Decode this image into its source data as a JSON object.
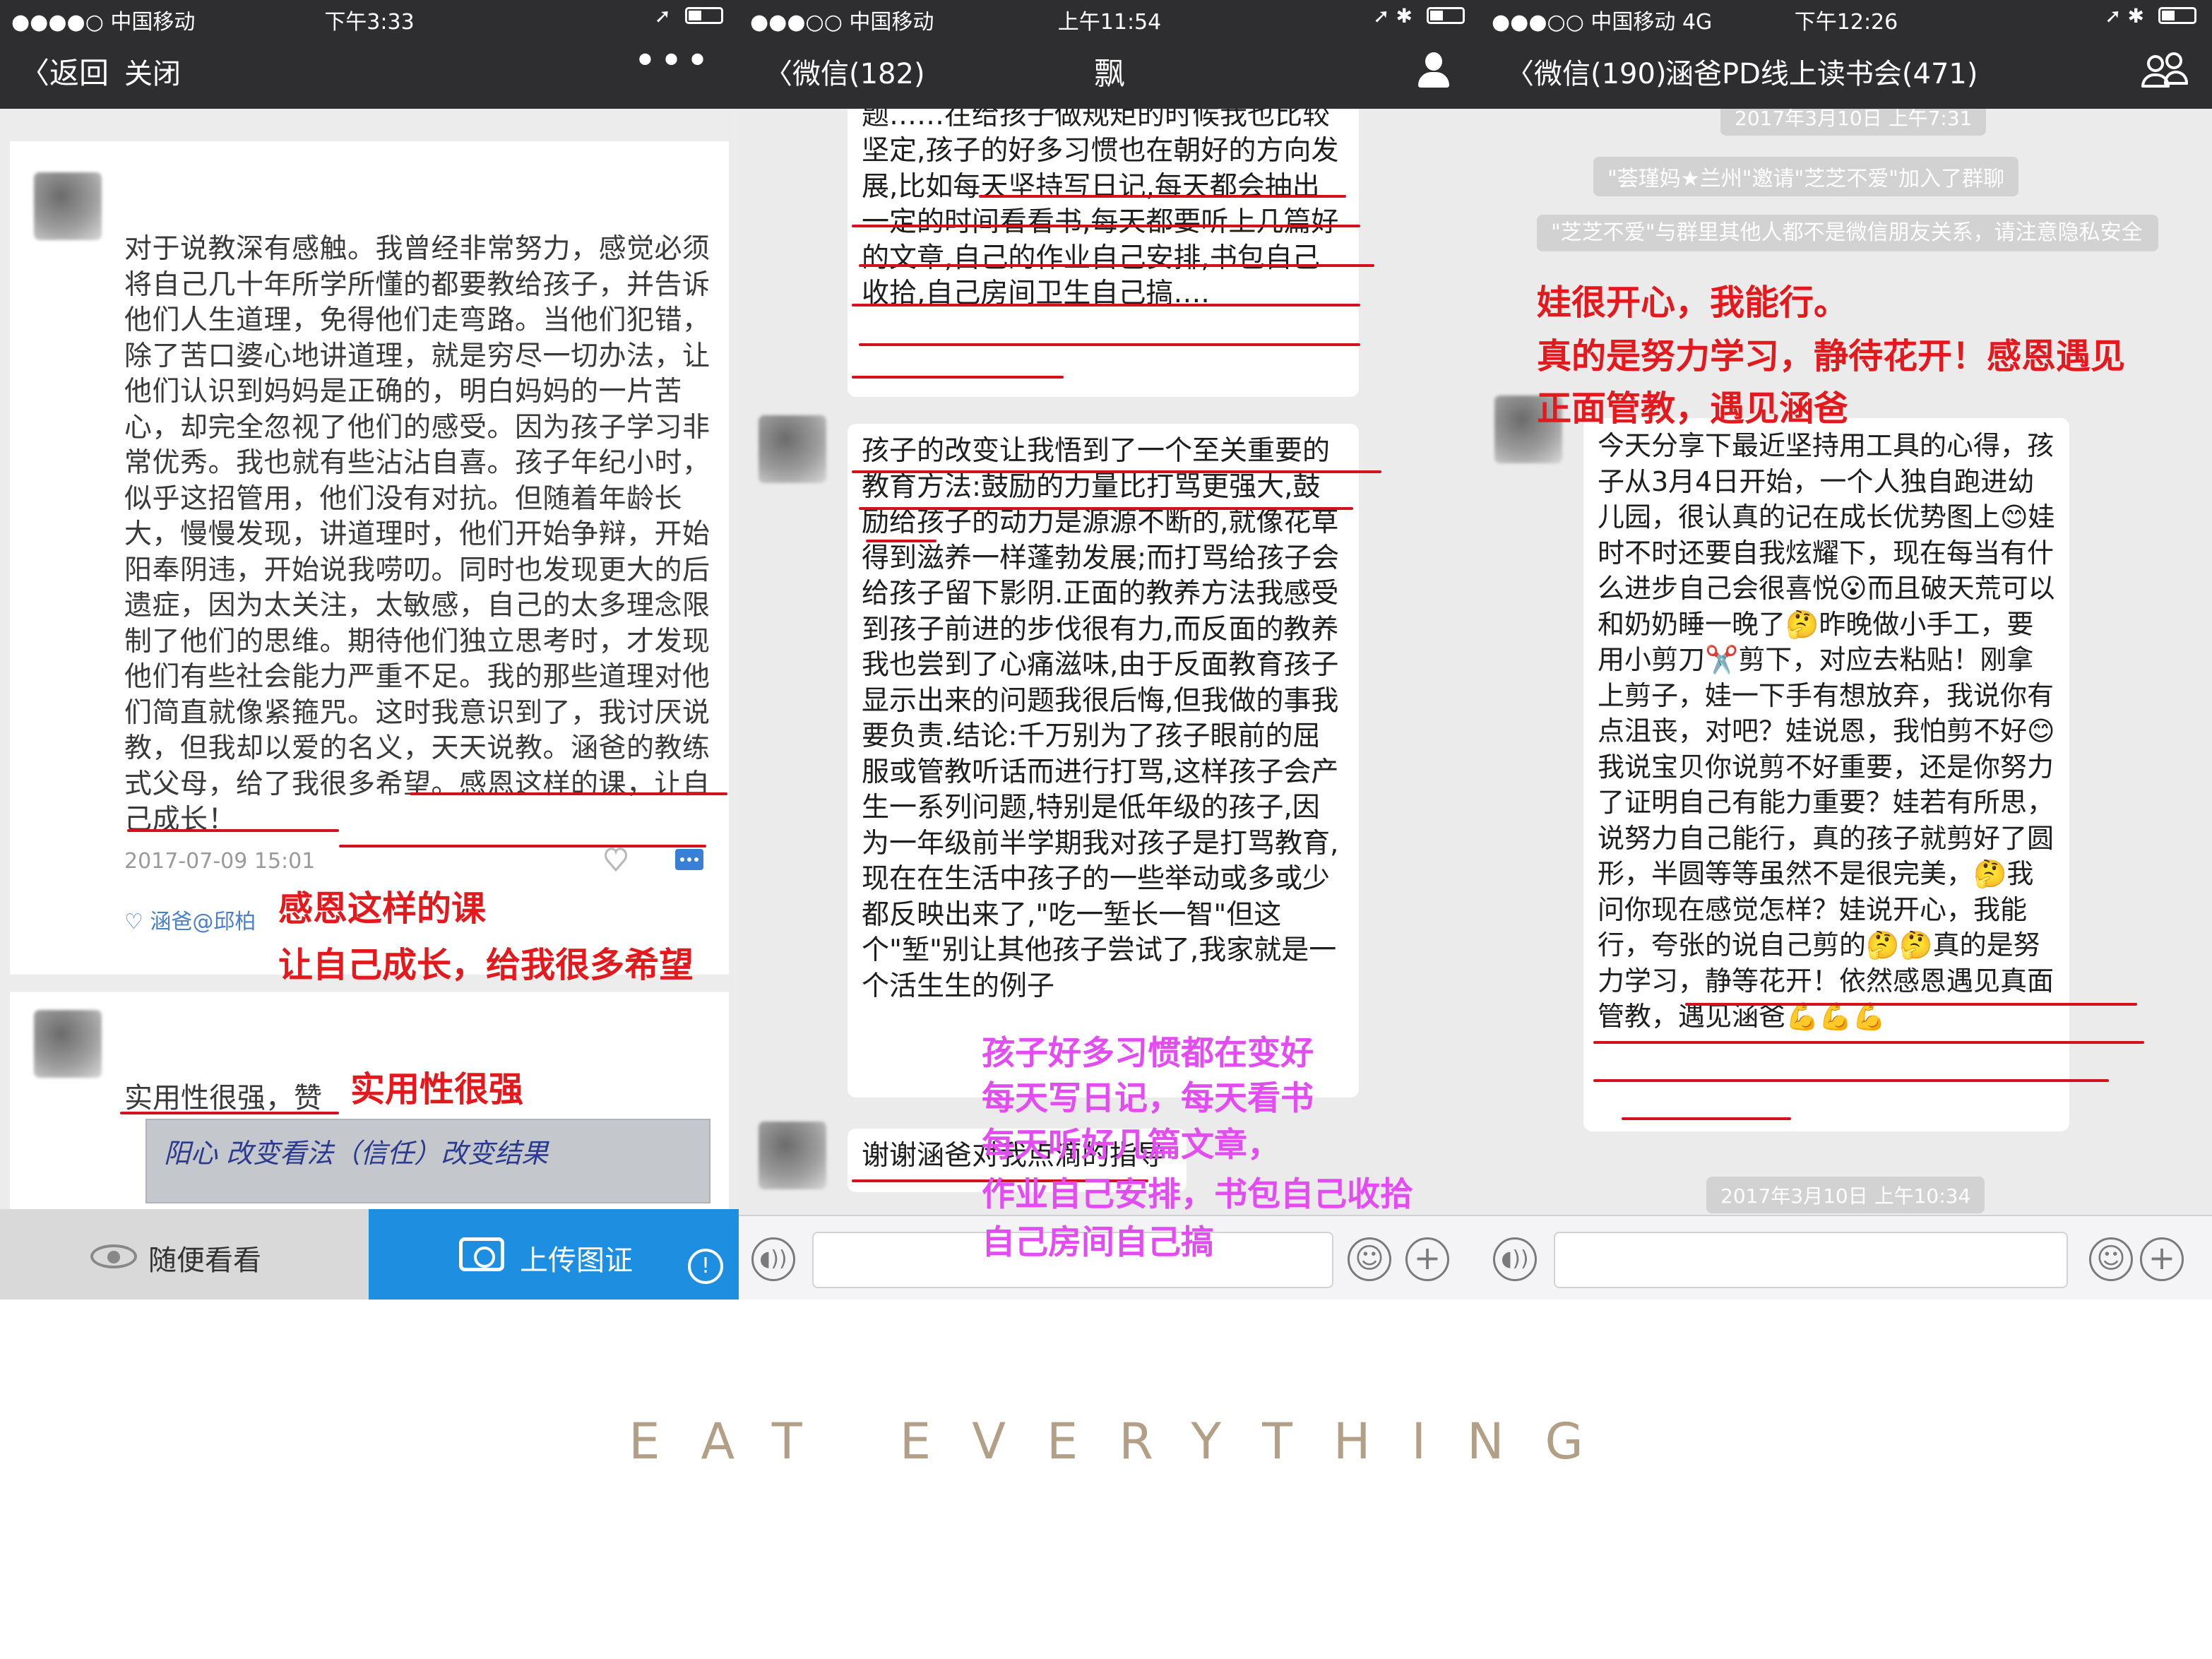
{
  "panel1": {
    "status": {
      "carrier": "●●●●○ 中国移动 ",
      "time": "下午3:33"
    },
    "nav": {
      "back": "〈返回",
      "close": "关闭",
      "more": "•••"
    },
    "post1": {
      "text": "对于说教深有感触。我曾经非常努力，感觉必须将自己几十年所学所懂的都要教给孩子，并告诉他们人生道理，免得他们走弯路。当他们犯错，除了苦口婆心地讲道理，就是穷尽一切办法，让他们认识到妈妈是正确的，明白妈妈的一片苦心，却完全忽视了他们的感受。因为孩子学习非常优秀。我也就有些沾沾自喜。孩子年纪小时，似乎这招管用，他们没有对抗。但随着年龄长大，慢慢发现，讲道理时，他们开始争辩，开始阳奉阴违，开始说我唠叨。同时也发现更大的后遗症，因为太关注，太敏感，自己的太多理念限制了他们的思维。期待他们独立思考时，才发现他们有些社会能力严重不足。我的那些道理对他们简直就像紧箍咒。这时我意识到了，我讨厌说教，但我却以爱的名义，天天说教。涵爸的教练式父母，给了我很多希望。感恩这样的课，让自己成长！",
      "date": "2017-07-09 15:01",
      "likes": "♡ 涵爸@邱柏"
    },
    "post2": {
      "text": "实用性很强，赞",
      "handwriting": "阳心 改变看法（信任）改变结果"
    },
    "bottom": {
      "browse": "随便看看",
      "upload": "上传图证",
      "info": "!"
    },
    "annotations": {
      "a1": "感恩这样的课",
      "a2": "让自己成长，给我很多希望",
      "a3": "实用性很强"
    }
  },
  "panel2": {
    "status": {
      "carrier": "●●●○○ 中国移动 ",
      "time": "上午11:54"
    },
    "nav": {
      "back": "〈微信(182)",
      "title": "飘"
    },
    "bubble1": "自己,尽量站在孩子的角度去思考问题……在给孩子做规矩的时候我也比较坚定,孩子的好多习惯也在朝好的方向发展,比如每天坚持写日记,每天都会抽出一定的时间看看书,每天都要听上几篇好的文章,自己的作业自己安排,书包自己收拾,自己房间卫生自己搞….",
    "bubble2": "孩子的改变让我悟到了一个至关重要的教育方法:鼓励的力量比打骂更强大,鼓励给孩子的动力是源源不断的,就像花草得到滋养一样蓬勃发展;而打骂给孩子会给孩子留下影阴.正面的教养方法我感受到孩子前进的步伐很有力,而反面的教养我也尝到了心痛滋味,由于反面教育孩子显示出来的问题我很后悔,但我做的事我要负责.结论:千万别为了孩子眼前的屈服或管教听话而进行打骂,这样孩子会产生一系列问题,特别是低年级的孩子,因为一年级前半学期我对孩子是打骂教育,现在在生活中孩子的一些举动或多或少都反映出来了,\"吃一堑长一智\"但这个\"堑\"别让其他孩子尝试了,我家就是一个活生生的例子",
    "bubble3": "谢谢涵爸对我点滴的指导",
    "annotations": [
      "孩子好多习惯都在变好",
      "每天写日记，每天看书",
      "每天听好几篇文章，",
      "作业自己安排，书包自己收拾",
      "自己房间自己搞"
    ]
  },
  "panel3": {
    "status": {
      "carrier": "●●●○○ 中国移动  4G",
      "time": "下午12:26"
    },
    "nav": {
      "back": "〈微信(190)",
      "title": "涵爸PD线上读书会(471)"
    },
    "stamp_top": "2017年3月10日 上午7:31",
    "system1": "\"荟瑾妈★兰州\"邀请\"芝芝不爱\"加入了群聊",
    "system2": "\"芝芝不爱\"与群里其他人都不是微信朋友关系，请注意隐私安全",
    "bubble": "今天分享下最近坚持用工具的心得，孩子从3月4日开始，一个人独自跑进幼儿园，很认真的记在成长优势图上😊娃时不时还要自我炫耀下，现在每当有什么进步自己会很喜悦😮而且破天荒可以和奶奶睡一晚了🤔昨晚做小手工，要用小剪刀✂️剪下，对应去粘贴！刚拿上剪子，娃一下手有想放弃，我说你有点沮丧，对吧？娃说恩，我怕剪不好😊我说宝贝你说剪不好重要，还是你努力了证明自己有能力重要？娃若有所思，说努力自己能行，真的孩子就剪好了圆形，半圆等等虽然不是很完美，🤔我问你现在感觉怎样？娃说开心，我能行，夸张的说自己剪的🤔🤔真的是努力学习，静等花开！依然感恩遇见真面管教，遇见涵爸💪💪💪",
    "stamp_bottom": "2017年3月10日 上午10:34",
    "annotations": {
      "a1": "娃很开心，我能行。",
      "a2": "真的是努力学习，静待花开！感恩遇见",
      "a3": "正面管教，遇见涵爸"
    }
  },
  "footer": "EAT  EVERYTHING",
  "colors": {
    "nav": "#2e2e30",
    "annotation_red": "#e3191e",
    "annotation_pink": "#e24cf0",
    "upload_blue": "#1e8ee0",
    "footer": "#b39e86"
  }
}
